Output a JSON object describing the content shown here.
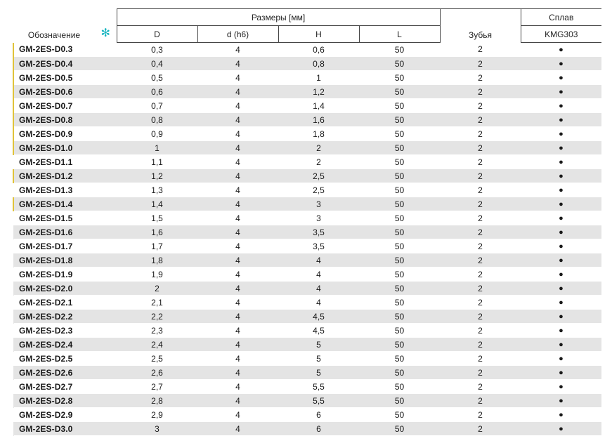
{
  "table": {
    "header": {
      "designation": "Обозначение",
      "star_symbol": "✻",
      "sizes_group": "Размеры [мм]",
      "col_D": "D",
      "col_d": "d (h6)",
      "col_H": "H",
      "col_L": "L",
      "teeth": "Зубья",
      "alloy_group": "Сплав",
      "alloy_grade": "KMG303"
    },
    "rows": [
      {
        "code": "GM-2ES-D0.3",
        "D": "0,3",
        "d": "4",
        "H": "0,6",
        "L": "50",
        "teeth": "2",
        "alloy": "●",
        "marked": true
      },
      {
        "code": "GM-2ES-D0.4",
        "D": "0,4",
        "d": "4",
        "H": "0,8",
        "L": "50",
        "teeth": "2",
        "alloy": "●",
        "marked": true
      },
      {
        "code": "GM-2ES-D0.5",
        "D": "0,5",
        "d": "4",
        "H": "1",
        "L": "50",
        "teeth": "2",
        "alloy": "●",
        "marked": true
      },
      {
        "code": "GM-2ES-D0.6",
        "D": "0,6",
        "d": "4",
        "H": "1,2",
        "L": "50",
        "teeth": "2",
        "alloy": "●",
        "marked": true
      },
      {
        "code": "GM-2ES-D0.7",
        "D": "0,7",
        "d": "4",
        "H": "1,4",
        "L": "50",
        "teeth": "2",
        "alloy": "●",
        "marked": true
      },
      {
        "code": "GM-2ES-D0.8",
        "D": "0,8",
        "d": "4",
        "H": "1,6",
        "L": "50",
        "teeth": "2",
        "alloy": "●",
        "marked": true
      },
      {
        "code": "GM-2ES-D0.9",
        "D": "0,9",
        "d": "4",
        "H": "1,8",
        "L": "50",
        "teeth": "2",
        "alloy": "●",
        "marked": true
      },
      {
        "code": "GM-2ES-D1.0",
        "D": "1",
        "d": "4",
        "H": "2",
        "L": "50",
        "teeth": "2",
        "alloy": "●",
        "marked": true
      },
      {
        "code": "GM-2ES-D1.1",
        "D": "1,1",
        "d": "4",
        "H": "2",
        "L": "50",
        "teeth": "2",
        "alloy": "●",
        "marked": false
      },
      {
        "code": "GM-2ES-D1.2",
        "D": "1,2",
        "d": "4",
        "H": "2,5",
        "L": "50",
        "teeth": "2",
        "alloy": "●",
        "marked": true
      },
      {
        "code": "GM-2ES-D1.3",
        "D": "1,3",
        "d": "4",
        "H": "2,5",
        "L": "50",
        "teeth": "2",
        "alloy": "●",
        "marked": false
      },
      {
        "code": "GM-2ES-D1.4",
        "D": "1,4",
        "d": "4",
        "H": "3",
        "L": "50",
        "teeth": "2",
        "alloy": "●",
        "marked": true
      },
      {
        "code": "GM-2ES-D1.5",
        "D": "1,5",
        "d": "4",
        "H": "3",
        "L": "50",
        "teeth": "2",
        "alloy": "●",
        "marked": false
      },
      {
        "code": "GM-2ES-D1.6",
        "D": "1,6",
        "d": "4",
        "H": "3,5",
        "L": "50",
        "teeth": "2",
        "alloy": "●",
        "marked": false
      },
      {
        "code": "GM-2ES-D1.7",
        "D": "1,7",
        "d": "4",
        "H": "3,5",
        "L": "50",
        "teeth": "2",
        "alloy": "●",
        "marked": false
      },
      {
        "code": "GM-2ES-D1.8",
        "D": "1,8",
        "d": "4",
        "H": "4",
        "L": "50",
        "teeth": "2",
        "alloy": "●",
        "marked": false
      },
      {
        "code": "GM-2ES-D1.9",
        "D": "1,9",
        "d": "4",
        "H": "4",
        "L": "50",
        "teeth": "2",
        "alloy": "●",
        "marked": false
      },
      {
        "code": "GM-2ES-D2.0",
        "D": "2",
        "d": "4",
        "H": "4",
        "L": "50",
        "teeth": "2",
        "alloy": "●",
        "marked": false
      },
      {
        "code": "GM-2ES-D2.1",
        "D": "2,1",
        "d": "4",
        "H": "4",
        "L": "50",
        "teeth": "2",
        "alloy": "●",
        "marked": false
      },
      {
        "code": "GM-2ES-D2.2",
        "D": "2,2",
        "d": "4",
        "H": "4,5",
        "L": "50",
        "teeth": "2",
        "alloy": "●",
        "marked": false
      },
      {
        "code": "GM-2ES-D2.3",
        "D": "2,3",
        "d": "4",
        "H": "4,5",
        "L": "50",
        "teeth": "2",
        "alloy": "●",
        "marked": false
      },
      {
        "code": "GM-2ES-D2.4",
        "D": "2,4",
        "d": "4",
        "H": "5",
        "L": "50",
        "teeth": "2",
        "alloy": "●",
        "marked": false
      },
      {
        "code": "GM-2ES-D2.5",
        "D": "2,5",
        "d": "4",
        "H": "5",
        "L": "50",
        "teeth": "2",
        "alloy": "●",
        "marked": false
      },
      {
        "code": "GM-2ES-D2.6",
        "D": "2,6",
        "d": "4",
        "H": "5",
        "L": "50",
        "teeth": "2",
        "alloy": "●",
        "marked": false
      },
      {
        "code": "GM-2ES-D2.7",
        "D": "2,7",
        "d": "4",
        "H": "5,5",
        "L": "50",
        "teeth": "2",
        "alloy": "●",
        "marked": false
      },
      {
        "code": "GM-2ES-D2.8",
        "D": "2,8",
        "d": "4",
        "H": "5,5",
        "L": "50",
        "teeth": "2",
        "alloy": "●",
        "marked": false
      },
      {
        "code": "GM-2ES-D2.9",
        "D": "2,9",
        "d": "4",
        "H": "6",
        "L": "50",
        "teeth": "2",
        "alloy": "●",
        "marked": false
      },
      {
        "code": "GM-2ES-D3.0",
        "D": "3",
        "d": "4",
        "H": "6",
        "L": "50",
        "teeth": "2",
        "alloy": "●",
        "marked": false
      }
    ],
    "colors": {
      "stripe": "#e4e4e4",
      "marker": "#e0c33a",
      "star": "#19b5c0"
    }
  }
}
